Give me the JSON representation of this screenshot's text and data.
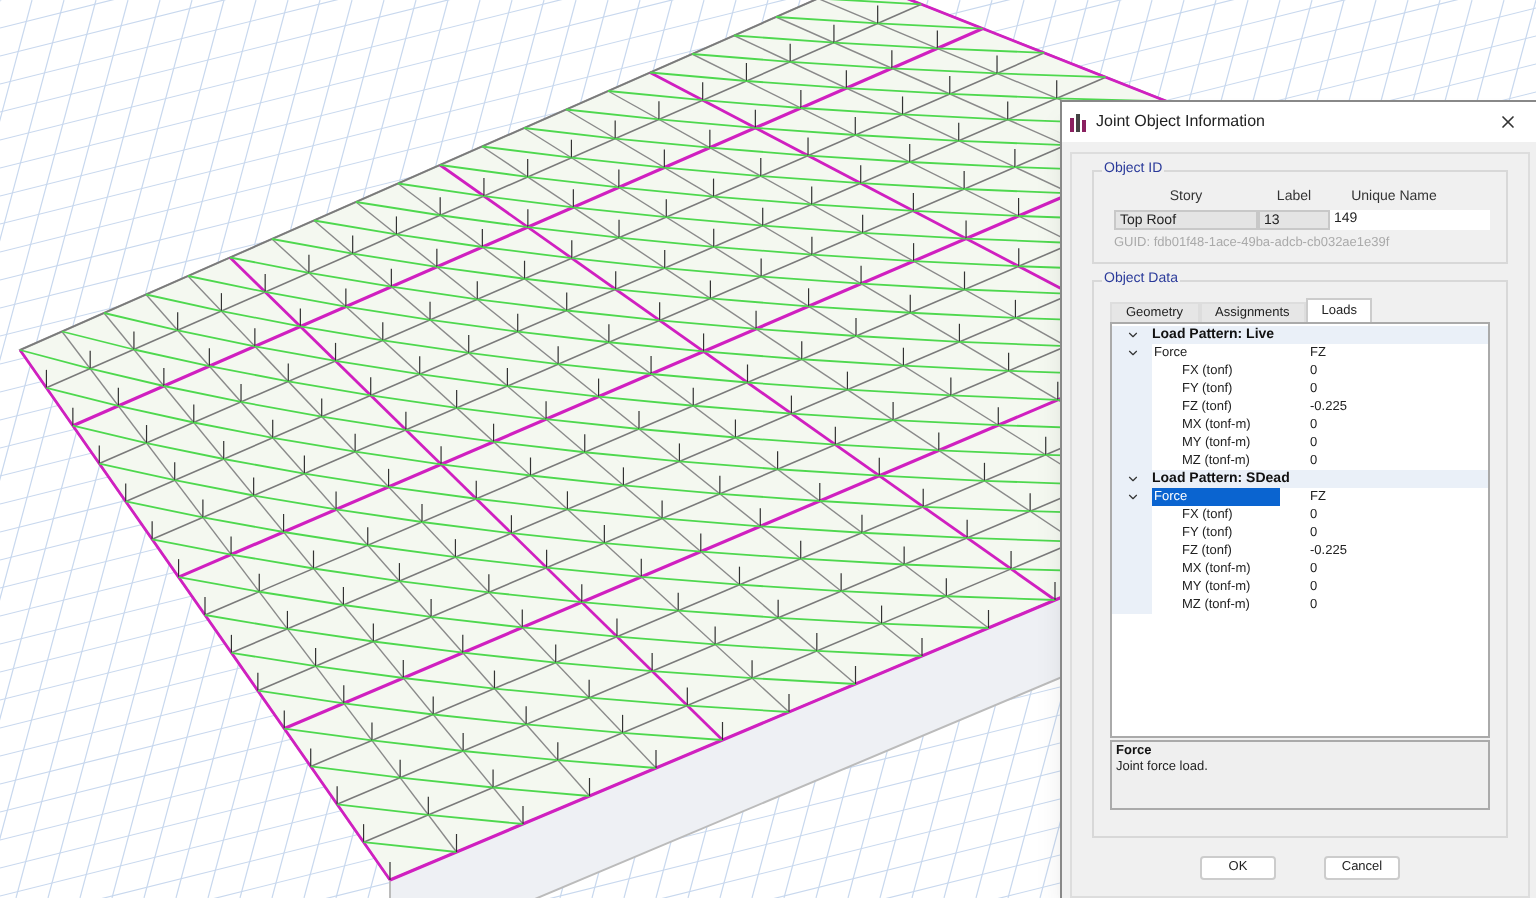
{
  "dialog": {
    "title": "Joint Object Information",
    "object_id": {
      "legend": "Object ID",
      "columns": [
        "Story",
        "Label",
        "Unique Name"
      ],
      "values": [
        "Top Roof",
        "13",
        "149"
      ],
      "guid": "GUID: fdb01f48-1ace-49ba-adcb-cb032ae1e39f"
    },
    "object_data": {
      "legend": "Object Data",
      "tabs": [
        {
          "label": "Geometry",
          "selected": false
        },
        {
          "label": "Assignments",
          "selected": false
        },
        {
          "label": "Loads",
          "selected": true
        }
      ],
      "tree": [
        {
          "label": "Load Pattern: Live",
          "expanded": true,
          "children": [
            {
              "label": "Force",
              "value": "FZ",
              "expanded": true,
              "selected": false,
              "children": [
                {
                  "label": "FX (tonf)",
                  "value": "0"
                },
                {
                  "label": "FY (tonf)",
                  "value": "0"
                },
                {
                  "label": "FZ (tonf)",
                  "value": "-0.225"
                },
                {
                  "label": "MX (tonf-m)",
                  "value": "0"
                },
                {
                  "label": "MY (tonf-m)",
                  "value": "0"
                },
                {
                  "label": "MZ (tonf-m)",
                  "value": "0"
                }
              ]
            }
          ]
        },
        {
          "label": "Load Pattern: SDead",
          "expanded": true,
          "children": [
            {
              "label": "Force",
              "value": "FZ",
              "expanded": true,
              "selected": true,
              "children": [
                {
                  "label": "FX (tonf)",
                  "value": "0"
                },
                {
                  "label": "FY (tonf)",
                  "value": "0"
                },
                {
                  "label": "FZ (tonf)",
                  "value": "-0.225"
                },
                {
                  "label": "MX (tonf-m)",
                  "value": "0"
                },
                {
                  "label": "MY (tonf-m)",
                  "value": "0"
                },
                {
                  "label": "MZ (tonf-m)",
                  "value": "0"
                }
              ]
            }
          ]
        }
      ],
      "description": {
        "title": "Force",
        "text": "Joint force load."
      }
    },
    "buttons": [
      "OK",
      "Cancel"
    ]
  }
}
